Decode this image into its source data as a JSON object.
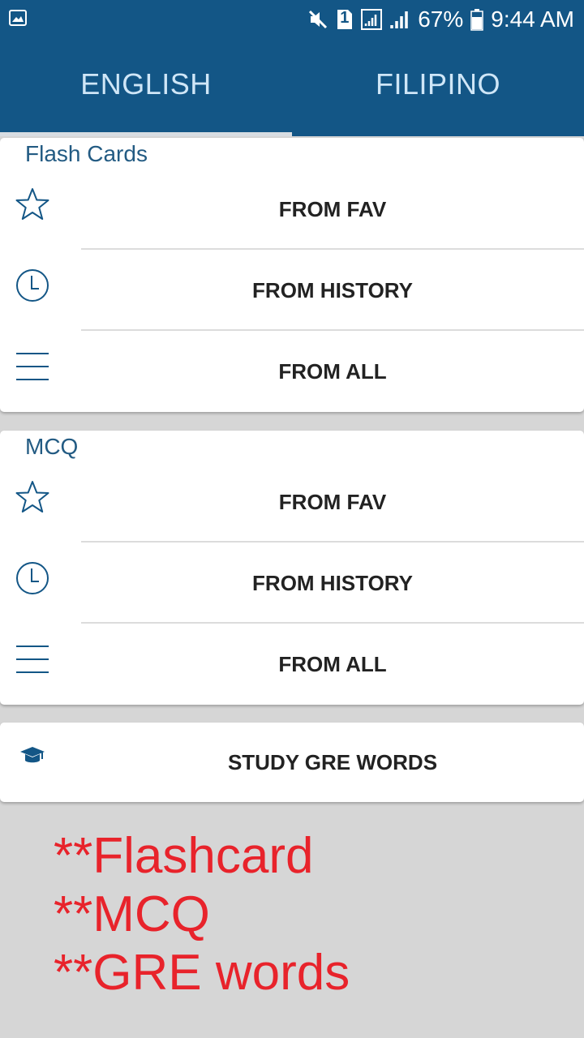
{
  "status_bar": {
    "battery_percent": "67%",
    "time": "9:44 AM",
    "sim_badge": "1",
    "icons": [
      "image-icon",
      "mute-icon",
      "sim-icon",
      "signal-icon",
      "battery-icon"
    ]
  },
  "tabs": [
    {
      "label": "ENGLISH",
      "active": true
    },
    {
      "label": "FILIPINO",
      "active": false
    }
  ],
  "flash_cards": {
    "title": "Flash Cards",
    "items": [
      {
        "label": "FROM FAV",
        "icon": "star-icon"
      },
      {
        "label": "FROM HISTORY",
        "icon": "clock-icon"
      },
      {
        "label": "FROM ALL",
        "icon": "list-icon"
      }
    ]
  },
  "mcq": {
    "title": "MCQ",
    "items": [
      {
        "label": "FROM FAV",
        "icon": "star-icon"
      },
      {
        "label": "FROM HISTORY",
        "icon": "clock-icon"
      },
      {
        "label": "FROM ALL",
        "icon": "list-icon"
      }
    ]
  },
  "gre": {
    "label": "STUDY GRE WORDS",
    "icon": "graduation-cap-icon"
  },
  "annotation": {
    "lines": [
      "**Flashcard",
      "**MCQ",
      "**GRE words"
    ],
    "color": "#e8232b"
  },
  "colors": {
    "primary": "#135686",
    "title": "#235b83",
    "background": "#d6d6d6"
  }
}
